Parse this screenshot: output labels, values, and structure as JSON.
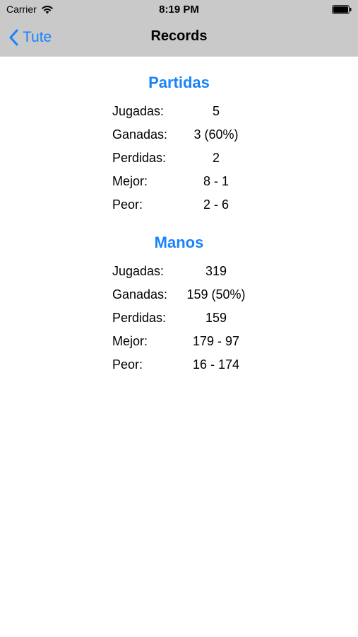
{
  "status_bar": {
    "carrier": "Carrier",
    "time": "8:19 PM"
  },
  "nav": {
    "back_label": "Tute",
    "title": "Records",
    "accent_color": "#1a82fb",
    "bar_color": "#c9c9c9"
  },
  "partidas": {
    "title": "Partidas",
    "rows": [
      {
        "label": "Jugadas:",
        "value": "5"
      },
      {
        "label": "Ganadas:",
        "value": "3 (60%)"
      },
      {
        "label": "Perdidas:",
        "value": "2"
      },
      {
        "label": "Mejor:",
        "value": "8 - 1"
      },
      {
        "label": "Peor:",
        "value": "2 - 6"
      }
    ]
  },
  "manos": {
    "title": "Manos",
    "rows": [
      {
        "label": "Jugadas:",
        "value": "319"
      },
      {
        "label": "Ganadas:",
        "value": "159 (50%)"
      },
      {
        "label": "Perdidas:",
        "value": "159"
      },
      {
        "label": "Mejor:",
        "value": "179 - 97"
      },
      {
        "label": "Peor:",
        "value": "16 - 174"
      }
    ]
  }
}
